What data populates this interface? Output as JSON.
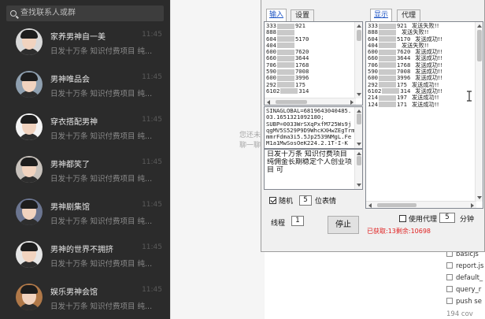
{
  "search": {
    "placeholder": "查找联系人或群"
  },
  "chats": [
    {
      "name": "家养男神自一美",
      "time": "11:45",
      "preview": "日发十万条 知识付费项目 纯..."
    },
    {
      "name": "男神唯品会",
      "time": "11:45",
      "preview": "日发十万条 知识付费项目 纯..."
    },
    {
      "name": "穿衣搭配男神",
      "time": "11:45",
      "preview": "日发十万条 知识付费项目 纯..."
    },
    {
      "name": "男神都笑了",
      "time": "11:45",
      "preview": "日发十万条 知识付费项目 纯..."
    },
    {
      "name": "男神剧集馆",
      "time": "11:45",
      "preview": "日发十万条 知识付费项目 纯..."
    },
    {
      "name": "男神的世界不拥挤",
      "time": "11:45",
      "preview": "日发十万条 知识付费项目 纯..."
    },
    {
      "name": "娱乐男神会馆",
      "time": "11:45",
      "preview": "日发十万条 知识付费项目 纯..."
    }
  ],
  "chat_hint": {
    "line1": "您还未",
    "line2": "聊一聊"
  },
  "tool": {
    "left_tabs": [
      "输入",
      "设置"
    ],
    "right_tabs": [
      "显示",
      "代理"
    ],
    "input_lines": [
      {
        "a": "333",
        "b": "921"
      },
      {
        "a": "888",
        "b": ""
      },
      {
        "a": "604",
        "b": "5170"
      },
      {
        "a": "404",
        "b": ""
      },
      {
        "a": "600",
        "b": "7620"
      },
      {
        "a": "660",
        "b": "3644"
      },
      {
        "a": "706",
        "b": "1768"
      },
      {
        "a": "590",
        "b": "7008"
      },
      {
        "a": "600",
        "b": "3996"
      },
      {
        "a": "292",
        "b": "175"
      },
      {
        "a": "6102",
        "b": "314"
      }
    ],
    "cookie_lines": [
      "SINAGLOBAL=6819643040485.",
      "03.1651321092180;",
      "SUBP=0033WrSXqPxfM725Ws9j",
      "qgMV5S529P9D9WhcKXHwZEgTrm3",
      "mmrFdma3i5.5Jp2539NMgL.Fe",
      "M1a1MwSosOeK224.2.1T-I-K"
    ],
    "message_lines": [
      "日发十万条 知识付费项目",
      "纯佣金长期稳定个人创业项",
      "目 可"
    ],
    "random_label": "随机",
    "random_value": "5",
    "random_suffix": "位表情",
    "thread_label": "线程",
    "thread_value": "1",
    "stop_label": "停止",
    "proxy_label": "使用代理",
    "proxy_value": "5",
    "proxy_unit": "分钟",
    "status": "已获取:13剩余:10698",
    "output_lines": [
      {
        "a": "333",
        "b": "921",
        "msg": "发送失败!!"
      },
      {
        "a": "888",
        "b": "",
        "msg": "发送失败!!"
      },
      {
        "a": "604",
        "b": "5170",
        "msg": "发送成功!!"
      },
      {
        "a": "404",
        "b": "",
        "msg": "发送失败!!"
      },
      {
        "a": "600",
        "b": "7620",
        "msg": "发送成功!!"
      },
      {
        "a": "660",
        "b": "3644",
        "msg": "发送成功!!"
      },
      {
        "a": "706",
        "b": "1768",
        "msg": "发送成功!!"
      },
      {
        "a": "590",
        "b": "7008",
        "msg": "发送成功!!"
      },
      {
        "a": "600",
        "b": "3996",
        "msg": "发送成功!!"
      },
      {
        "a": "292",
        "b": "175",
        "msg": "发送成功!!"
      },
      {
        "a": "6102",
        "b": "314",
        "msg": "发送成功!!"
      },
      {
        "a": "214",
        "b": "197",
        "msg": "发送成功!!"
      },
      {
        "a": "124",
        "b": "171",
        "msg": "发送成功!!"
      }
    ]
  },
  "files": [
    "basicjs",
    "report.js",
    "default_",
    "query_r",
    "push se",
    "194 cov"
  ],
  "colors": {
    "chat_bg": "#2b2b2b",
    "status_red": "#e02020",
    "tab_active": "#1f56c5"
  }
}
